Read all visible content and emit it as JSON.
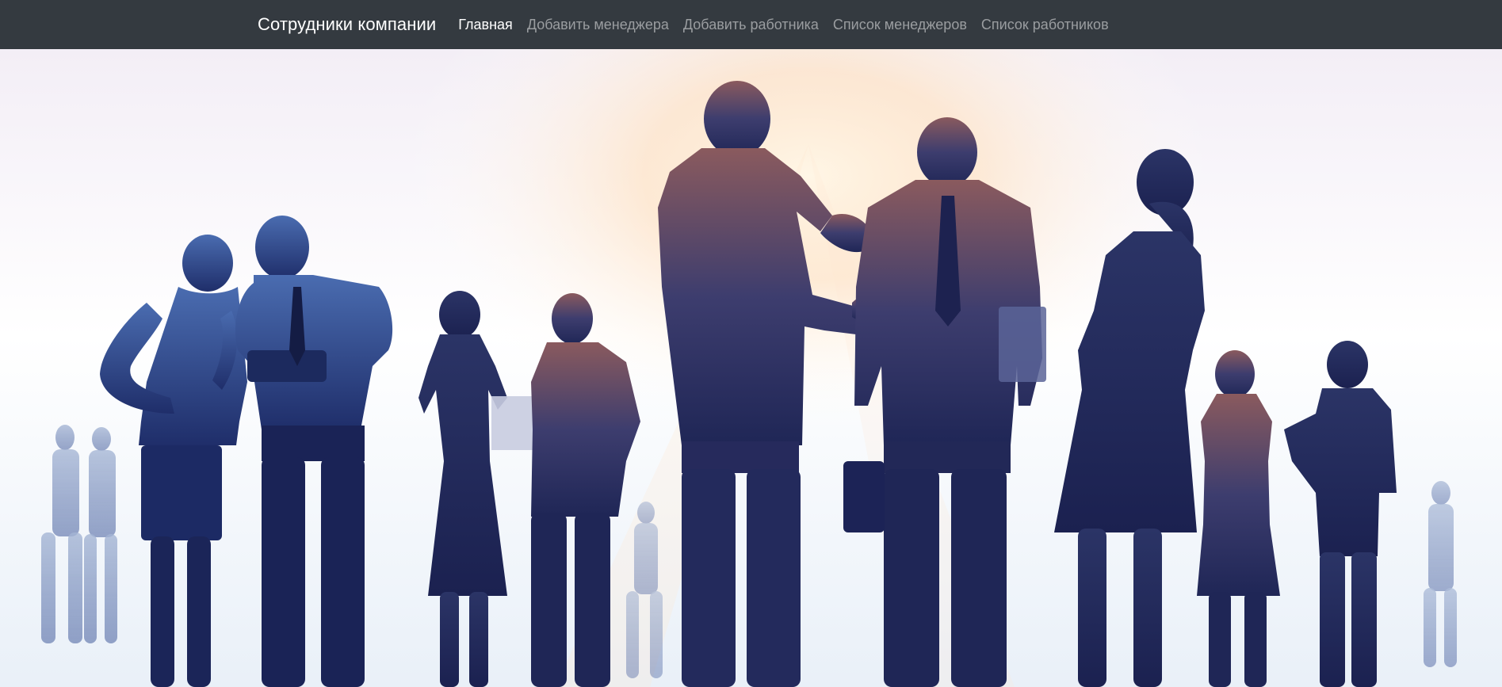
{
  "navbar": {
    "brand": "Сотрудники компании",
    "links": [
      {
        "label": "Главная",
        "active": true
      },
      {
        "label": "Добавить менеджера",
        "active": false
      },
      {
        "label": "Добавить работника",
        "active": false
      },
      {
        "label": "Список менеджеров",
        "active": false
      },
      {
        "label": "Список работников",
        "active": false
      }
    ]
  },
  "colors": {
    "navbar_bg": "#343a40",
    "nav_active": "#ffffff",
    "nav_inactive": "#9a9da0",
    "silhouette_dark": "#1e2550",
    "silhouette_blue": "#3a5a9c",
    "sunburst": "#f2b48a"
  },
  "hero": {
    "image": "business-people-silhouettes"
  }
}
